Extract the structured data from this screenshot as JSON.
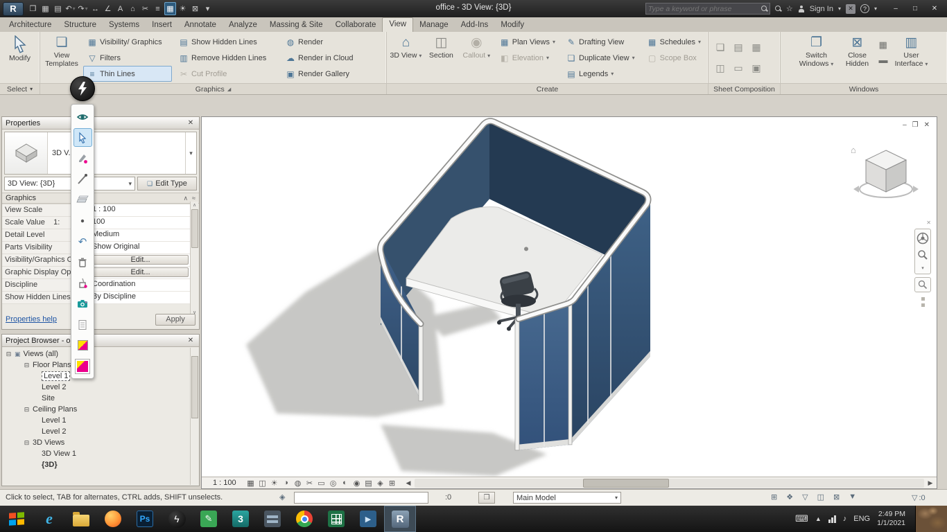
{
  "icons": {
    "dropdown": "▾",
    "dropdown_small": "⌄",
    "close": "✕",
    "minimize": "–",
    "restore": "❐",
    "maximize": "□",
    "collapse": "∧",
    "wave": "≈",
    "expander": "⊟",
    "views_root": "▣",
    "scroll_left": "◀",
    "scroll_right": "▶",
    "scroll_up": "∧",
    "scroll_down": "∨",
    "help": "?",
    "star": "☆",
    "circle": "◎",
    "launcher": "◢"
  },
  "titlebar": {
    "app_label": "R",
    "title": "office - 3D View: {3D}",
    "search_placeholder": "Type a keyword or phrase",
    "sign_in": "Sign In",
    "qat": [
      {
        "name": "open-icon",
        "glyph": "❒"
      },
      {
        "name": "save-icon",
        "glyph": "▦"
      },
      {
        "name": "print-icon",
        "glyph": "▤"
      },
      {
        "name": "undo-icon",
        "glyph": "↶",
        "arrow": true
      },
      {
        "name": "redo-icon",
        "glyph": "↷",
        "arrow": true
      },
      {
        "name": "measure-icon",
        "glyph": "↔"
      },
      {
        "name": "dimension-icon",
        "glyph": "∠"
      },
      {
        "name": "text-icon",
        "glyph": "A"
      },
      {
        "name": "default-3d-view-icon",
        "glyph": "⌂"
      },
      {
        "name": "section-icon",
        "glyph": "✂"
      },
      {
        "name": "thin-lines-icon",
        "glyph": "≡"
      },
      {
        "name": "visual-style-icon",
        "glyph": "▦",
        "active": true
      },
      {
        "name": "sun-icon",
        "glyph": "☀"
      },
      {
        "name": "close-inactive-icon",
        "glyph": "⊠"
      },
      {
        "name": "qat-customize-icon",
        "glyph": "▾"
      }
    ]
  },
  "tabs": [
    {
      "label": "Architecture"
    },
    {
      "label": "Structure"
    },
    {
      "label": "Systems"
    },
    {
      "label": "Insert"
    },
    {
      "label": "Annotate"
    },
    {
      "label": "Analyze"
    },
    {
      "label": "Massing & Site"
    },
    {
      "label": "Collaborate"
    },
    {
      "label": "View",
      "active": true
    },
    {
      "label": "Manage"
    },
    {
      "label": "Add-Ins"
    },
    {
      "label": "Modify"
    }
  ],
  "ribbon": {
    "select": {
      "label": "Select",
      "modify_label": "Modify"
    },
    "graphics": {
      "label": "Graphics",
      "view_templates_label": "View Templates",
      "view_templates_glyph": "❏",
      "col1": [
        {
          "label": "Visibility/ Graphics",
          "glyph": "▦"
        },
        {
          "label": "Filters",
          "glyph": "▽"
        },
        {
          "label": "Thin Lines",
          "glyph": "≡",
          "active": true
        }
      ],
      "col2": [
        {
          "label": "Show Hidden Lines",
          "glyph": "▤"
        },
        {
          "label": "Remove Hidden Lines",
          "glyph": "▥"
        },
        {
          "label": "Cut Profile",
          "glyph": "✂",
          "disabled": true
        }
      ],
      "col3": [
        {
          "label": "Render",
          "glyph": "◍"
        },
        {
          "label": "Render in Cloud",
          "glyph": "☁"
        },
        {
          "label": "Render Gallery",
          "glyph": "▣"
        }
      ]
    },
    "create": {
      "label": "Create",
      "big": [
        {
          "label": "3D View",
          "glyph": "⌂",
          "arrow": true
        },
        {
          "label": "Section",
          "glyph": "◫"
        },
        {
          "label": "Callout",
          "glyph": "◉",
          "arrow": true,
          "disabled": true
        }
      ],
      "colA": [
        {
          "label": "Plan Views",
          "glyph": "▦",
          "arrow": true
        },
        {
          "label": "Elevation",
          "glyph": "◧",
          "arrow": true,
          "disabled": true
        }
      ],
      "colB": [
        {
          "label": "Drafting View",
          "glyph": "✎"
        },
        {
          "label": "Duplicate View",
          "glyph": "❏",
          "arrow": true
        },
        {
          "label": "Legends",
          "glyph": "▤",
          "arrow": true
        }
      ],
      "colC": [
        {
          "label": "Schedules",
          "glyph": "▦",
          "arrow": true
        },
        {
          "label": "Scope Box",
          "glyph": "▢",
          "disabled": true
        }
      ]
    },
    "sheet": {
      "label": "Sheet Composition",
      "grid": [
        {
          "name": "new-sheet-icon",
          "glyph": "❏"
        },
        {
          "name": "title-block-icon",
          "glyph": "▤"
        },
        {
          "name": "revisions-icon",
          "glyph": "▦"
        },
        {
          "name": "guide-grid-icon",
          "glyph": "◫"
        },
        {
          "name": "matchline-icon",
          "glyph": "▭"
        },
        {
          "name": "view-reference-icon",
          "glyph": "▣"
        }
      ]
    },
    "windows": {
      "label": "Windows",
      "switch_label": "Switch Windows",
      "close_label": "Close Hidden",
      "ui_label": "User Interface",
      "small": [
        {
          "name": "tab-views-icon",
          "glyph": "▦"
        },
        {
          "name": "tile-views-icon",
          "glyph": "▬"
        }
      ]
    }
  },
  "properties": {
    "title": "Properties",
    "type_label": "3D V...",
    "selector_value": "3D View: {3D}",
    "edit_type_label": "Edit Type",
    "section_label": "Graphics",
    "rows": [
      {
        "label": "View Scale",
        "value": "1 : 100"
      },
      {
        "label": "Scale Value    1:",
        "value": "100"
      },
      {
        "label": "Detail Level",
        "value": "Medium"
      },
      {
        "label": "Parts Visibility",
        "value": "Show Original"
      },
      {
        "label": "Visibility/Graphics Over",
        "value": "Edit...",
        "button": true
      },
      {
        "label": "Graphic Display Options",
        "value": "Edit...",
        "button": true
      },
      {
        "label": "Discipline",
        "value": "Coordination"
      },
      {
        "label": "Show Hidden Lines",
        "value": "By Discipline"
      }
    ],
    "apply_label": "Apply",
    "help_label": "Properties help"
  },
  "browser": {
    "title": "Project Browser - o...",
    "tree": [
      {
        "label": "Views (all)"
      },
      {
        "label": "Floor Plans"
      },
      {
        "label": "Level 1"
      },
      {
        "label": "Level 2"
      },
      {
        "label": "Site"
      },
      {
        "label": "Ceiling Plans"
      },
      {
        "label": "Level 1"
      },
      {
        "label": "Level 2"
      },
      {
        "label": "3D Views"
      },
      {
        "label": "3D View 1"
      },
      {
        "label": "{3D}"
      }
    ]
  },
  "viewport": {
    "scale_label": "1 : 100",
    "view_controls": [
      {
        "name": "detail-level-icon",
        "glyph": "▦"
      },
      {
        "name": "visual-style-icon",
        "glyph": "◫"
      },
      {
        "name": "sun-path-icon",
        "glyph": "☀"
      },
      {
        "name": "shadows-icon",
        "glyph": "◑"
      },
      {
        "name": "render-dialog-icon",
        "glyph": "◍"
      },
      {
        "name": "crop-view-icon",
        "glyph": "✂"
      },
      {
        "name": "crop-region-icon",
        "glyph": "▭"
      },
      {
        "name": "unlocked-view-icon",
        "glyph": "◎"
      },
      {
        "name": "temporary-hide-icon",
        "glyph": "◐"
      },
      {
        "name": "reveal-hidden-icon",
        "glyph": "◉"
      },
      {
        "name": "worksharing-display-icon",
        "glyph": "▤"
      },
      {
        "name": "displaced-elements-icon",
        "glyph": "◈"
      },
      {
        "name": "constraints-icon",
        "glyph": "⊞"
      }
    ]
  },
  "statusbar": {
    "message": "Click to select, TAB for alternates, CTRL adds, SHIFT unselects.",
    "selection_count": ":0",
    "main_model": "Main Model",
    "filter_count": ":0",
    "right_icons": [
      {
        "name": "worksets-icon",
        "glyph": "⊞"
      },
      {
        "name": "design-options-icon",
        "glyph": "❖"
      },
      {
        "name": "select-links-icon",
        "glyph": "▽"
      },
      {
        "name": "select-underlay-icon",
        "glyph": "◫"
      },
      {
        "name": "select-pinned-icon",
        "glyph": "⊠"
      },
      {
        "name": "filter-icon",
        "glyph": "▼"
      }
    ]
  },
  "taskbar": {
    "language": "ENG",
    "time": "2:49 PM",
    "date": "1/1/2021",
    "apps": [
      {
        "name": "start-button"
      },
      {
        "name": "internet-explorer",
        "label": "e"
      },
      {
        "name": "file-explorer"
      },
      {
        "name": "firefox"
      },
      {
        "name": "photoshop",
        "label": "Ps"
      },
      {
        "name": "picpick",
        "glyph": "ϟ"
      },
      {
        "name": "notes-app",
        "glyph": "✎"
      },
      {
        "name": "3ds-max",
        "label": "3"
      },
      {
        "name": "media-app"
      },
      {
        "name": "chrome"
      },
      {
        "name": "spreadsheet-app"
      },
      {
        "name": "video-app",
        "glyph": "▶"
      },
      {
        "name": "revit",
        "label": "R",
        "active": true
      }
    ]
  },
  "floating_toolbar": {
    "tools": [
      "show-icon",
      "cursor-icon",
      "highlighter-icon",
      "pen-icon",
      "whiteboard-icon",
      "dot-icon",
      "undo-icon",
      "trash-icon",
      "pen-cup-icon",
      "capture-icon",
      "notes-icon",
      "color-swatch-icon",
      "color-picker-icon"
    ]
  },
  "colors": {
    "wall_navy": "#3a5878",
    "accent_blue": "#7fa8cd",
    "magenta": "#ec008c",
    "yellow": "#ffe000"
  }
}
